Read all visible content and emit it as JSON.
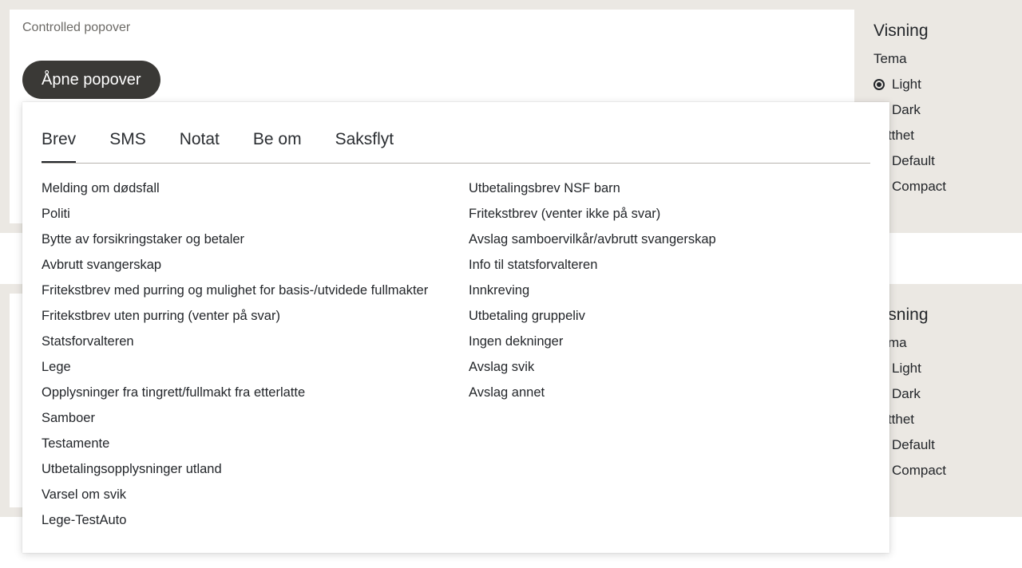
{
  "story": {
    "label": "Controlled popover",
    "open_button": "Åpne popover"
  },
  "settings": {
    "title": "Visning",
    "theme_label": "Tema",
    "theme_options": [
      "Light",
      "Dark"
    ],
    "theme_selected": "Light",
    "density_label": "Tetthet",
    "density_options": [
      "Default",
      "Compact"
    ]
  },
  "popover": {
    "tabs": [
      "Brev",
      "SMS",
      "Notat",
      "Be om",
      "Saksflyt"
    ],
    "active_tab": "Brev",
    "left_items": [
      "Melding om dødsfall",
      "Politi",
      "Bytte av forsikringstaker og betaler",
      "Avbrutt svangerskap",
      "Fritekstbrev med purring og mulighet for basis-/utvidede fullmakter",
      "Fritekstbrev uten purring (venter på svar)",
      "Statsforvalteren",
      "Lege",
      "Opplysninger fra tingrett/fullmakt fra etterlatte",
      "Samboer",
      "Testamente",
      "Utbetalingsopplysninger utland",
      "Varsel om svik",
      "Lege-TestAuto"
    ],
    "right_items": [
      "Utbetalingsbrev NSF barn",
      "Fritekstbrev (venter ikke på svar)",
      "Avslag samboervilkår/avbrutt svangerskap",
      "Info til statsforvalteren",
      "Innkreving",
      "Utbetaling gruppeliv",
      "Ingen dekninger",
      "Avslag svik",
      "Avslag annet"
    ]
  }
}
